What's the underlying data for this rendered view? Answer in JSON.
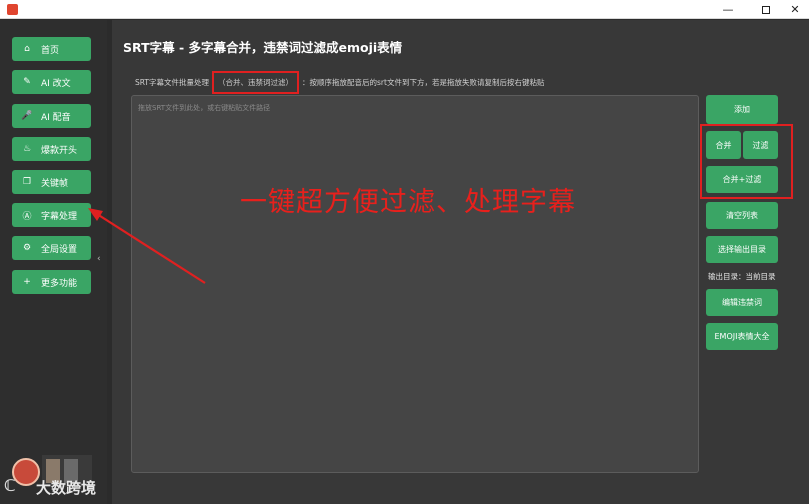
{
  "window": {
    "title": "",
    "min_glyph": "—",
    "close_glyph": "✕"
  },
  "sidebar": {
    "items": [
      {
        "label": "首页",
        "icon": "home-icon",
        "glyph": "⌂"
      },
      {
        "label": "AI 改文",
        "icon": "pencil-icon",
        "glyph": "✎"
      },
      {
        "label": "AI 配音",
        "icon": "microphone-icon",
        "glyph": "🎤"
      },
      {
        "label": "爆款开头",
        "icon": "fire-icon",
        "glyph": "♨"
      },
      {
        "label": "关键帧",
        "icon": "copy-icon",
        "glyph": "❐"
      },
      {
        "label": "字幕处理",
        "icon": "subtitle-icon",
        "glyph": "Ⓐ"
      },
      {
        "label": "全局设置",
        "icon": "gear-icon",
        "glyph": "⚙"
      },
      {
        "label": "更多功能",
        "icon": "plus-icon",
        "glyph": "+"
      }
    ],
    "active_index": 5,
    "collapse_glyph": "‹"
  },
  "main": {
    "title": "SRT字幕 - 多字幕合并，违禁词过滤成emoji表情",
    "desc_prefix": "SRT字幕文件批量处理",
    "desc_highlight": "（合并、违禁词过滤）",
    "desc_suffix": "：按顺序拖放配音后的srt文件到下方，若是拖放失败请复制后按右键粘贴",
    "drop_placeholder": "拖放SRT文件到此处，或右键粘贴文件路径"
  },
  "actions": {
    "add": "添加",
    "merge": "合并",
    "filter": "过滤",
    "merge_filter": "合并+过滤",
    "clear": "清空列表",
    "choose_output": "选择输出目录",
    "output_label": "输出目录：当前目录",
    "edit_banned": "编辑违禁词",
    "emoji": "EMOJI表情大全"
  },
  "annotation": {
    "text": "一键超方便过滤、处理字幕"
  },
  "watermark": {
    "text": "大数跨境",
    "logo_glyph": "ℂ"
  },
  "colors": {
    "accent_green": "#3aa565",
    "annotation_red": "#e8201c",
    "background": "#2b2b2b"
  }
}
